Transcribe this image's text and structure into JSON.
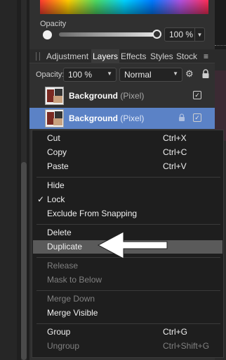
{
  "color_panel": {
    "opacity_label": "Opacity",
    "opacity_value": "100 %"
  },
  "tabs": [
    "Adjustment",
    "Layers",
    "Effects",
    "Styles",
    "Stock"
  ],
  "active_tab": "Layers",
  "layers_toolbar": {
    "opacity_label": "Opacity:",
    "opacity_value": "100 %",
    "blend_mode": "Normal"
  },
  "layers": [
    {
      "name": "Background",
      "type": "(Pixel)",
      "selected": false
    },
    {
      "name": "Background",
      "type": "(Pixel)",
      "selected": true
    }
  ],
  "context_menu": {
    "cut": {
      "label": "Cut",
      "shortcut": "Ctrl+X"
    },
    "copy": {
      "label": "Copy",
      "shortcut": "Ctrl+C"
    },
    "paste": {
      "label": "Paste",
      "shortcut": "Ctrl+V"
    },
    "hide": {
      "label": "Hide"
    },
    "lock": {
      "label": "Lock"
    },
    "exclude": {
      "label": "Exclude From Snapping"
    },
    "delete": {
      "label": "Delete"
    },
    "duplicate": {
      "label": "Duplicate"
    },
    "release": {
      "label": "Release"
    },
    "mask_below": {
      "label": "Mask to Below"
    },
    "merge_down": {
      "label": "Merge Down"
    },
    "merge_visible": {
      "label": "Merge Visible"
    },
    "group": {
      "label": "Group",
      "shortcut": "Ctrl+G"
    },
    "ungroup": {
      "label": "Ungroup",
      "shortcut": "Ctrl+Shift+G"
    }
  },
  "icons": {
    "tab_menu": "menu-icon",
    "settings": "gear-icon",
    "lock": "lock-icon",
    "checkbox": "checkbox-icon",
    "checkmark": "checkmark-icon",
    "annotation": "arrow-icon"
  },
  "colors": {
    "selection": "#5b82c6",
    "menu_bg": "#1e1e1e",
    "highlight": "#5a5a5a"
  }
}
